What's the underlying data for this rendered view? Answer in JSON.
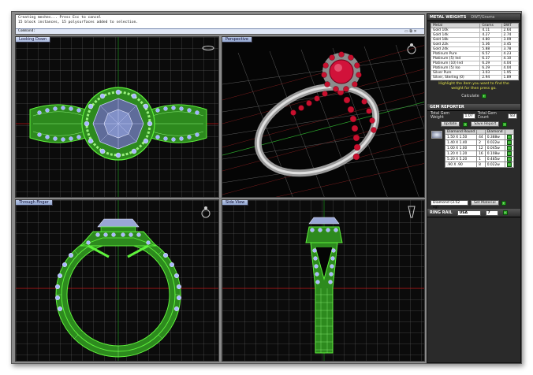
{
  "command": {
    "lines": [
      "Creating meshes... Press Esc to cancel",
      "15 block instances, 15 polysurfaces added to selection."
    ],
    "prompt": "Command:"
  },
  "viewports": {
    "top_left": "Looking Down",
    "top_right": "Perspective",
    "bottom_left": "Through Finger",
    "bottom_right": "Side View"
  },
  "metal_weights": {
    "title": "METAL WEIGHTS",
    "subtitle": "DWT/Grams",
    "columns": [
      "Metal",
      "Grams",
      "DWT"
    ],
    "rows": [
      [
        "Gold 10k",
        "4.11",
        "2.64"
      ],
      [
        "Gold 14k",
        "4.27",
        "2.74"
      ],
      [
        "Gold 18k",
        "4.80",
        "3.09"
      ],
      [
        "Gold 22k",
        "5.36",
        "3.45"
      ],
      [
        "Gold 24k",
        "5.88",
        "3.78"
      ],
      [
        "Platinum Pure",
        "6.57",
        "4.23"
      ],
      [
        "Platinum (5) Ind",
        "6.37",
        "4.10"
      ],
      [
        "Platinum (10) Ind",
        "6.29",
        "4.04"
      ],
      [
        "Platinum (5) Iso",
        "6.29",
        "4.04"
      ],
      [
        "Silver Pure",
        "3.03",
        "1.95"
      ],
      [
        "Silver, Sterling (0)",
        "2.94",
        "1.89"
      ]
    ],
    "hint": "Highlight the item you want to find the weight for then press go.",
    "calculate_label": "Calculate"
  },
  "gem_reporter": {
    "title": "GEM REPORTER",
    "total_weight_label": "Total Gem Weight",
    "total_weight_value": "1.07",
    "total_count_label": "Total Gem Count",
    "total_count_value": "83",
    "update_label": "Update",
    "save_report_label": "Save Report",
    "columns": [
      "Diamond Round",
      "",
      "",
      "Diamond"
    ],
    "rows": [
      [
        "1.50 X 1.50",
        "44",
        "0.388w"
      ],
      [
        "1.40 X 1.40",
        "2",
        "0.022w"
      ],
      [
        "1.00 X 1.00",
        "12",
        "0.045w"
      ],
      [
        "1.20 X 1.20",
        "16",
        "0.108w"
      ],
      [
        "5.20 X 5.20",
        "1",
        "0.485w"
      ],
      [
        ".90 X .90",
        "8",
        "0.022w"
      ]
    ],
    "material_value": "Diamond (3.52 sg)",
    "set_material_label": "Set Material"
  },
  "ring_rail": {
    "label": "RING RAIL",
    "country": "USA",
    "size": "7"
  },
  "colors": {
    "wire": "#5ff23c",
    "ruby": "#c8102e",
    "grid": "#7a7a7a",
    "panel_bg": "#2a2a2a",
    "accent_blue": "#1e3f8c"
  }
}
